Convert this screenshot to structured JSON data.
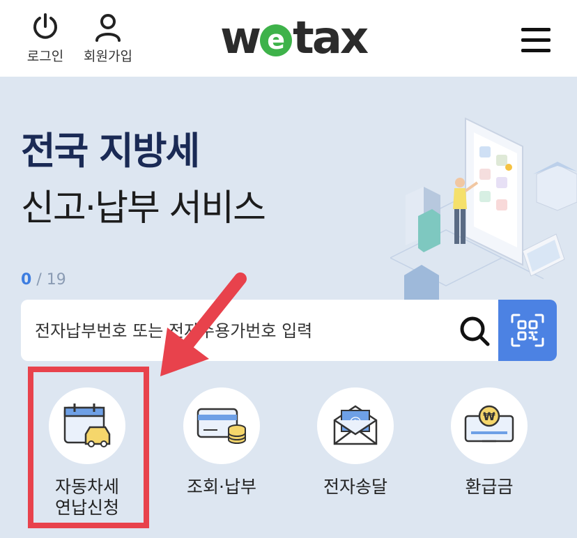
{
  "header": {
    "login_label": "로그인",
    "signup_label": "회원가입",
    "logo_left": "w",
    "logo_e": "e",
    "logo_right": "tax",
    "icons": [
      "power-icon",
      "user-icon",
      "menu-icon"
    ]
  },
  "hero": {
    "title": "전국 지방세",
    "subtitle": "신고·납부 서비스"
  },
  "counter": {
    "current": "0",
    "total": "/ 19"
  },
  "search": {
    "placeholder": "전자납부번호 또는 전자수용가번호 입력",
    "icons": [
      "search-icon",
      "qr-code-icon"
    ]
  },
  "quick_menu": [
    {
      "line1": "자동차세",
      "line2": "연납신청",
      "icon": "calendar-car-icon"
    },
    {
      "line1": "조회·납부",
      "line2": "",
      "icon": "card-coins-icon"
    },
    {
      "line1": "전자송달",
      "line2": "",
      "icon": "email-envelope-icon"
    },
    {
      "line1": "환급금",
      "line2": "",
      "icon": "won-monitor-icon"
    }
  ],
  "colors": {
    "background": "#dde6f1",
    "accent": "#4c82e3",
    "logo_green": "#3eb24a",
    "annotation_red": "#e8424c"
  }
}
